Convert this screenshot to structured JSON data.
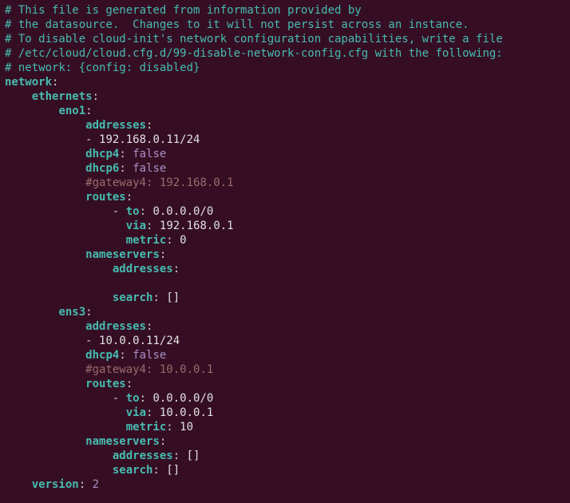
{
  "comments": {
    "l1": "# This file is generated from information provided by",
    "l2": "# the datasource.  Changes to it will not persist across an instance.",
    "l3": "# To disable cloud-init's network configuration capabilities, write a file",
    "l4": "# /etc/cloud/cloud.cfg.d/99-disable-network-config.cfg with the following:",
    "l5": "# network: {config: disabled}"
  },
  "keys": {
    "network": "network",
    "ethernets": "ethernets",
    "eno1": "eno1",
    "addresses": "addresses",
    "dhcp4": "dhcp4",
    "dhcp6": "dhcp6",
    "routes": "routes",
    "to": "to",
    "via": "via",
    "metric": "metric",
    "nameservers": "nameservers",
    "search": "search",
    "ens3": "ens3",
    "version": "version"
  },
  "values": {
    "eno1_addr": "192.168.0.11/24",
    "false": "false",
    "gateway4_eno1": "#gateway4: 192.168.0.1",
    "route_to": "0.0.0.0/0",
    "eno1_via": "192.168.0.1",
    "eno1_metric": "0",
    "empty_list": "[]",
    "ens3_addr": "10.0.0.11/24",
    "gateway4_ens3": "#gateway4: 10.0.0.1",
    "ens3_via": "10.0.0.1",
    "ens3_metric": "10",
    "version_val": "2"
  },
  "punct": {
    "colon": ":",
    "dash": "-",
    "dashsp": "- "
  }
}
